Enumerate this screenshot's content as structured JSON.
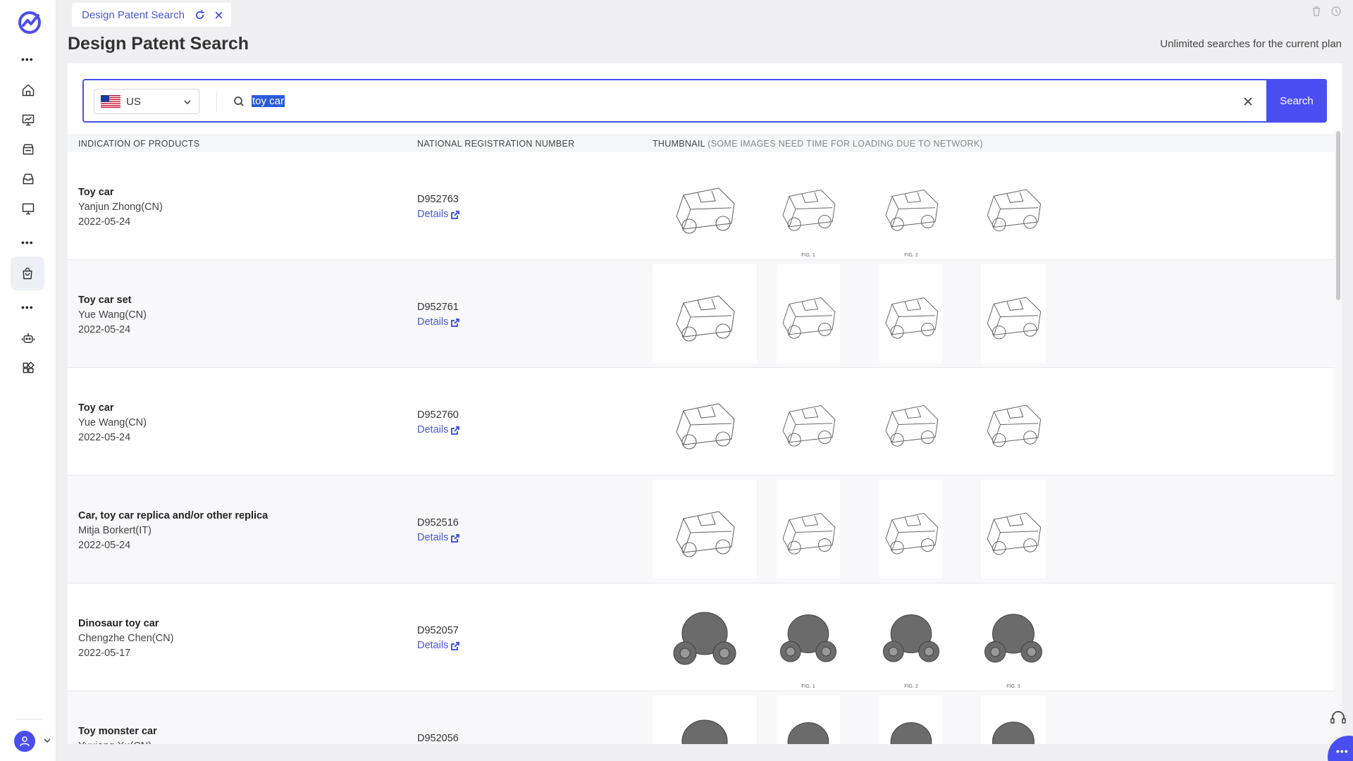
{
  "tab": {
    "label": "Design Patent Search"
  },
  "page": {
    "title": "Design Patent Search",
    "plan_note": "Unlimited searches for the current plan"
  },
  "search": {
    "country": "US",
    "query": "toy car",
    "button_label": "Search"
  },
  "table": {
    "columns": {
      "products": "INDICATION OF PRODUCTS",
      "reg_number": "NATIONAL REGISTRATION NUMBER",
      "thumbnail": "THUMBNAIL",
      "thumbnail_note": "(SOME IMAGES NEED TIME FOR LOADING DUE TO NETWORK)"
    },
    "details_label": "Details",
    "rows": [
      {
        "product": "Toy car",
        "owner": "Yanjun Zhong(CN)",
        "date": "2022-05-24",
        "reg": "D952763",
        "figs": [
          "",
          "FIG. 1",
          "FIG. 2",
          ""
        ]
      },
      {
        "product": "Toy car set",
        "owner": "Yue Wang(CN)",
        "date": "2022-05-24",
        "reg": "D952761",
        "figs": [
          "",
          "",
          "",
          ""
        ]
      },
      {
        "product": "Toy car",
        "owner": "Yue Wang(CN)",
        "date": "2022-05-24",
        "reg": "D952760",
        "figs": [
          "",
          "",
          "",
          ""
        ]
      },
      {
        "product": "Car, toy car replica and/or other replica",
        "owner": "Mitja Borkert(IT)",
        "date": "2022-05-24",
        "reg": "D952516",
        "figs": [
          "",
          "",
          "",
          ""
        ]
      },
      {
        "product": "Dinosaur toy car",
        "owner": "Chengzhe Chen(CN)",
        "date": "2022-05-17",
        "reg": "D952057",
        "figs": [
          "",
          "FIG. 1",
          "FIG. 2",
          "FIG. 3"
        ]
      },
      {
        "product": "Toy monster car",
        "owner": "Yuxiong Xu(CN)",
        "date": "",
        "reg": "D952056",
        "figs": [
          "",
          "",
          "",
          ""
        ]
      }
    ]
  },
  "icons": {
    "logo": "analytics-logo-icon",
    "rail": [
      "more-icon",
      "home-icon",
      "monitor-chart-icon",
      "store-icon",
      "inbox-icon",
      "desktop-icon",
      "more-icon",
      "shopping-bag-icon",
      "more-icon",
      "robot-icon",
      "apps-icon"
    ],
    "accent": "#4a4ef0"
  }
}
